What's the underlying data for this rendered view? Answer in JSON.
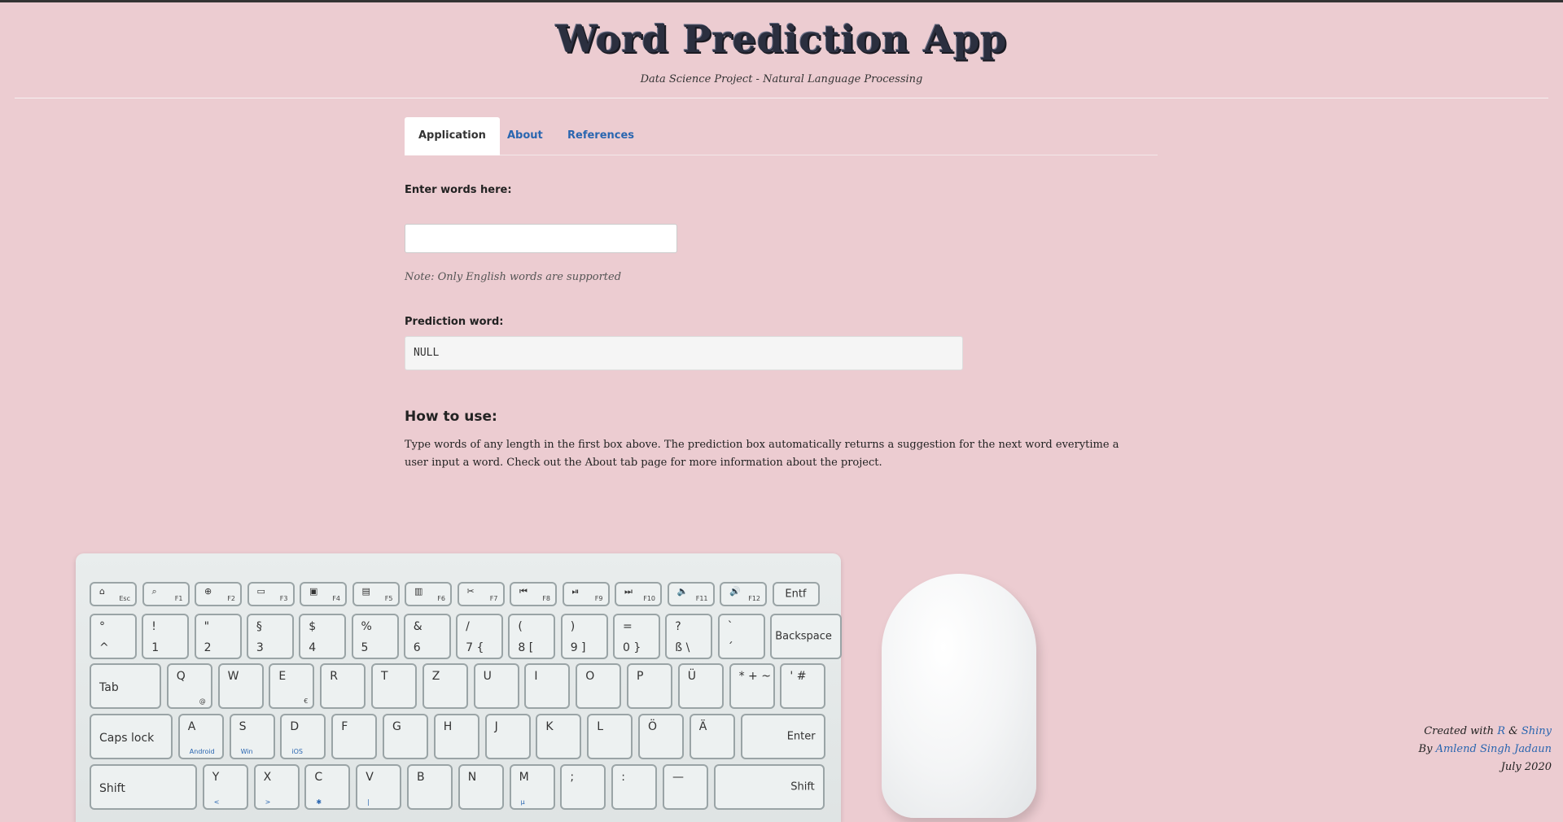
{
  "header": {
    "title": "Word Prediction App",
    "subtitle": "Data Science Project - Natural Language Processing"
  },
  "tabs": [
    {
      "label": "Application",
      "active": true
    },
    {
      "label": "About",
      "active": false
    },
    {
      "label": "References",
      "active": false
    }
  ],
  "input": {
    "label": "Enter words here:",
    "value": "",
    "note": "Note: Only English words are supported"
  },
  "prediction": {
    "label": "Prediction word:",
    "value": "NULL"
  },
  "howto": {
    "heading": "How to use:",
    "text": "Type words of any length in the first box above. The prediction box automatically returns a suggestion for the next word everytime a user input a word. Check out the About tab page for more information about the project."
  },
  "footer": {
    "created_prefix": "Created with",
    "r_link": "R",
    "amp": "&",
    "shiny_link": "Shiny",
    "by_prefix": "By",
    "author_link": "Amlend Singh Jadaun",
    "date": "July 2020"
  },
  "keyboard": {
    "row1": [
      {
        "m": "⌂",
        "s": "Esc"
      },
      {
        "m": "⌕",
        "s": "F1"
      },
      {
        "m": "⊕",
        "s": "F2"
      },
      {
        "m": "▭",
        "s": "F3"
      },
      {
        "m": "▣",
        "s": "F4"
      },
      {
        "m": "▤",
        "s": "F5"
      },
      {
        "m": "▥",
        "s": "F6"
      },
      {
        "m": "✂",
        "s": "F7"
      },
      {
        "m": "⏮",
        "s": "F8"
      },
      {
        "m": "⏯",
        "s": "F9"
      },
      {
        "m": "⏭",
        "s": "F10"
      },
      {
        "m": "🔈",
        "s": "F11"
      },
      {
        "m": "🔊",
        "s": "F12"
      },
      {
        "m": "Entf",
        "s": ""
      }
    ],
    "row2": [
      {
        "t": "°",
        "b": "^"
      },
      {
        "t": "!",
        "b": "1"
      },
      {
        "t": "\"",
        "b": "2"
      },
      {
        "t": "§",
        "b": "3"
      },
      {
        "t": "$",
        "b": "4"
      },
      {
        "t": "%",
        "b": "5"
      },
      {
        "t": "&",
        "b": "6"
      },
      {
        "t": "/",
        "b": "7  {"
      },
      {
        "t": "(",
        "b": "8  ["
      },
      {
        "t": ")",
        "b": "9  ]"
      },
      {
        "t": "=",
        "b": "0  }"
      },
      {
        "t": "?",
        "b": "ß  \\"
      },
      {
        "t": "`",
        "b": "´"
      },
      {
        "t": "Backspace",
        "b": ""
      }
    ],
    "row3": [
      "Tab",
      "Q",
      "W",
      "E",
      "R",
      "T",
      "Z",
      "U",
      "I",
      "O",
      "P",
      "Ü",
      "*  +  ~",
      "'  #"
    ],
    "row3_sub": {
      "Q": "@",
      "E": "€"
    },
    "row4": [
      "Caps lock",
      "A",
      "S",
      "D",
      "F",
      "G",
      "H",
      "J",
      "K",
      "L",
      "Ö",
      "Ä",
      "Enter"
    ],
    "row4_sub": {
      "A": "Android",
      "S": "Win",
      "D": "iOS"
    },
    "row5": [
      "Shift",
      "Y",
      "X",
      "C",
      "V",
      "B",
      "N",
      "M",
      ";",
      ":",
      "—",
      "Shift"
    ],
    "row5_sub": {
      "Y": "<",
      "X": ">",
      "C": "✱",
      "V": "|",
      "M": "µ"
    }
  },
  "colors": {
    "background": "#ecccd1",
    "link": "#2a66b0",
    "title": "#2b2f3f"
  }
}
